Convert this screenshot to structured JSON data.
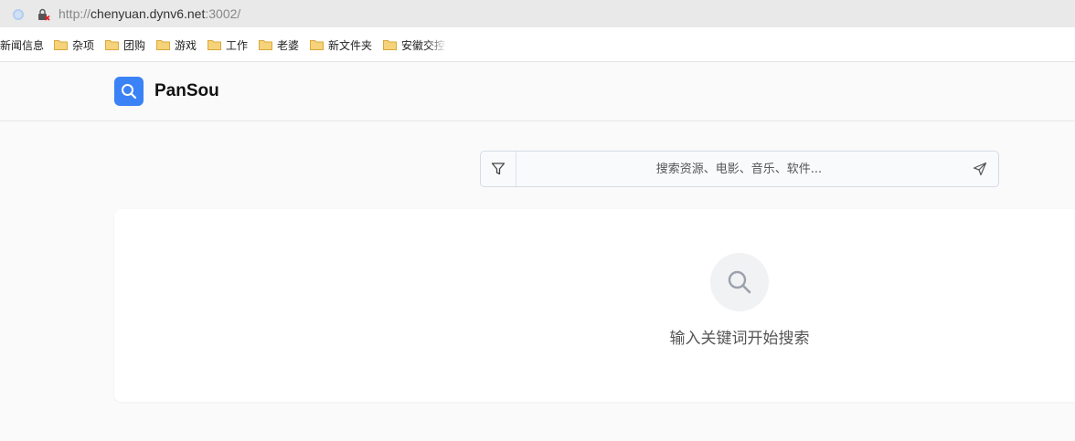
{
  "browser": {
    "url_protocol": "http://",
    "url_host": "chenyuan.dynv6.net",
    "url_port": ":3002/",
    "bookmarks": [
      {
        "label": "新闻信息",
        "folder": false
      },
      {
        "label": "杂项",
        "folder": true
      },
      {
        "label": "团购",
        "folder": true
      },
      {
        "label": "游戏",
        "folder": true
      },
      {
        "label": "工作",
        "folder": true
      },
      {
        "label": "老婆",
        "folder": true
      },
      {
        "label": "新文件夹",
        "folder": true
      },
      {
        "label": "安徽交控",
        "folder": true
      }
    ]
  },
  "app": {
    "brand": "PanSou",
    "accent_color": "#3b82f6"
  },
  "search": {
    "placeholder": "搜索资源、电影、音乐、软件...",
    "value": ""
  },
  "results": {
    "empty_message": "输入关键词开始搜索"
  },
  "icons": {
    "filter": "filter-icon",
    "send": "send-icon",
    "search": "search-icon",
    "folder": "folder-icon"
  }
}
